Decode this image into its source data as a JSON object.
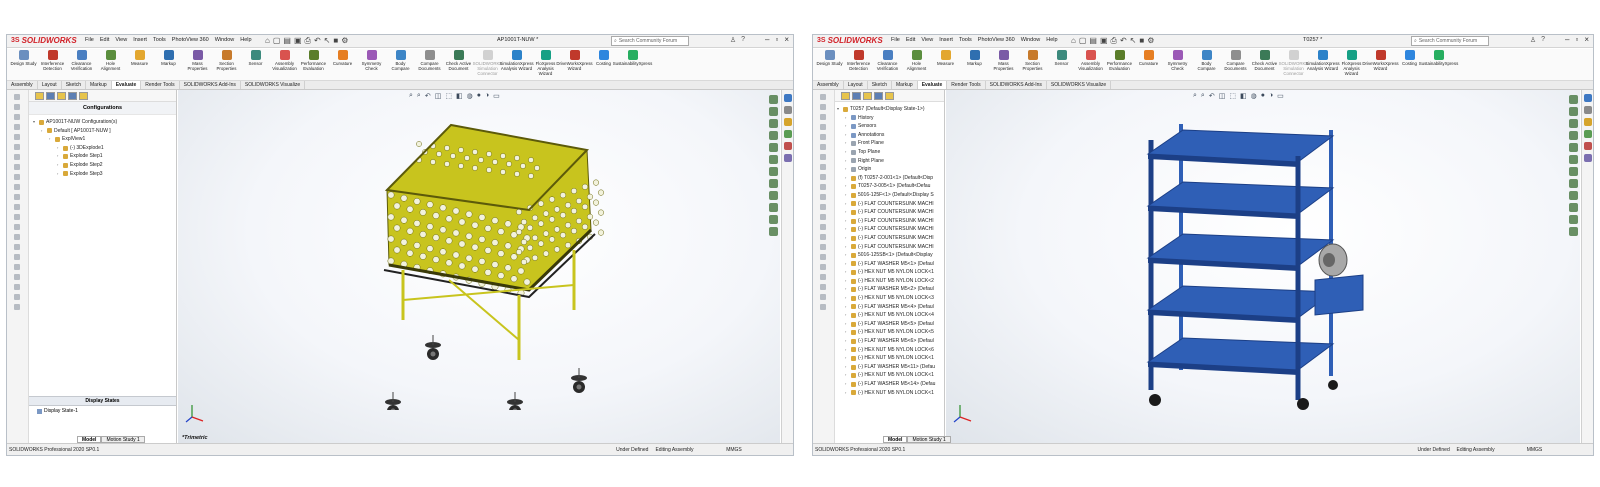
{
  "common": {
    "app_name": "SOLIDWORKS",
    "app_mark": "3S",
    "menus": [
      "File",
      "Edit",
      "View",
      "Insert",
      "Tools",
      "PhotoView 360",
      "Window",
      "Help"
    ],
    "search_placeholder": "Search Community Forum",
    "tools": [
      "Design Study",
      "Interference Detection",
      "Clearance Verification",
      "Hole Alignment",
      "Measure",
      "Markup",
      "Mass Properties",
      "Section Properties",
      "Sensor",
      "Assembly Visualization",
      "Performance Evaluation",
      "Curvature",
      "Symmetry Check",
      "Body Compare",
      "Compare Documents",
      "Check Active Document",
      "SOLIDWORKS Simulation Connector",
      "SimulationXpress Analysis Wizard",
      "FloXpress Analysis Wizard",
      "DriveWorksXpress Wizard",
      "Costing",
      "SustainabilityXpress"
    ],
    "tabs": [
      "Assembly",
      "Layout",
      "Sketch",
      "Markup",
      "Evaluate",
      "Render Tools",
      "SOLIDWORKS Add-Ins",
      "SOLIDWORKS Visualize"
    ],
    "active_tab": "Evaluate",
    "bottom_tabs": [
      "Model",
      "Motion Study 1"
    ],
    "status": {
      "product": "SOLIDWORKS Professional 2020 SP0.1",
      "state": "Under Defined",
      "mode": "Editing Assembly",
      "units": "MMGS"
    }
  },
  "left": {
    "doc_title": "AP1001T-NUW *",
    "panel_title": "Configurations",
    "tree": [
      {
        "text": "AP1001T-NUW Configuration(s)",
        "depth": 0
      },
      {
        "text": "Default [ AP1001T-NUW ]",
        "depth": 1
      },
      {
        "text": "ExplView1",
        "depth": 2
      },
      {
        "text": "(-) 3DExplode1",
        "depth": 3
      },
      {
        "text": "Explode Step1",
        "depth": 3
      },
      {
        "text": "Explode Step2",
        "depth": 3
      },
      {
        "text": "Explode Step3",
        "depth": 3
      }
    ],
    "display_states_title": "Display States",
    "display_state": "Display State-1",
    "view_name": "*Trimetric",
    "model_color": "#c8c41e"
  },
  "right": {
    "doc_title": "T0257 *",
    "tree": [
      {
        "text": "T0257 (Default<Display State-1>)",
        "depth": 0,
        "k": "a"
      },
      {
        "text": "History",
        "depth": 1,
        "k": "f"
      },
      {
        "text": "Sensors",
        "depth": 1,
        "k": "f"
      },
      {
        "text": "Annotations",
        "depth": 1,
        "k": "f"
      },
      {
        "text": "Front Plane",
        "depth": 1,
        "k": "p"
      },
      {
        "text": "Top Plane",
        "depth": 1,
        "k": "p"
      },
      {
        "text": "Right Plane",
        "depth": 1,
        "k": "p"
      },
      {
        "text": "Origin",
        "depth": 1,
        "k": "p"
      },
      {
        "text": "(f) T0257-2-001<1> (Default<Disp",
        "depth": 1,
        "k": "a"
      },
      {
        "text": "T0257-3-005<1> (Default<Defau",
        "depth": 1,
        "k": "a"
      },
      {
        "text": "5016-125F<1> (Default<Display S",
        "depth": 1,
        "k": "a"
      },
      {
        "text": "(-) FLAT COUNTERSUNK MACHI",
        "depth": 1,
        "k": "a"
      },
      {
        "text": "(-) FLAT COUNTERSUNK MACHI",
        "depth": 1,
        "k": "a"
      },
      {
        "text": "(-) FLAT COUNTERSUNK MACHI",
        "depth": 1,
        "k": "a"
      },
      {
        "text": "(-) FLAT COUNTERSUNK MACHI",
        "depth": 1,
        "k": "a"
      },
      {
        "text": "(-) FLAT COUNTERSUNK MACHI",
        "depth": 1,
        "k": "a"
      },
      {
        "text": "(-) FLAT COUNTERSUNK MACHI",
        "depth": 1,
        "k": "a"
      },
      {
        "text": "5016-125SB<1> (Default<Display",
        "depth": 1,
        "k": "a"
      },
      {
        "text": "(-) FLAT WASHER M5<1> (Defaul",
        "depth": 1,
        "k": "a"
      },
      {
        "text": "(-) HEX NUT M5 NYLON LOCK<1",
        "depth": 1,
        "k": "a"
      },
      {
        "text": "(-) HEX NUT M5 NYLON LOCK<2",
        "depth": 1,
        "k": "a"
      },
      {
        "text": "(-) FLAT WASHER M5<2> (Defaul",
        "depth": 1,
        "k": "a"
      },
      {
        "text": "(-) HEX NUT M5 NYLON LOCK<3",
        "depth": 1,
        "k": "a"
      },
      {
        "text": "(-) FLAT WASHER M5<4> (Defaul",
        "depth": 1,
        "k": "a"
      },
      {
        "text": "(-) HEX NUT M5 NYLON LOCK<4",
        "depth": 1,
        "k": "a"
      },
      {
        "text": "(-) FLAT WASHER M5<5> (Defaul",
        "depth": 1,
        "k": "a"
      },
      {
        "text": "(-) HEX NUT M5 NYLON LOCK<5",
        "depth": 1,
        "k": "a"
      },
      {
        "text": "(-) FLAT WASHER M5<6> (Defaul",
        "depth": 1,
        "k": "a"
      },
      {
        "text": "(-) HEX NUT M5 NYLON LOCK<6",
        "depth": 1,
        "k": "a"
      },
      {
        "text": "(-) HEX NUT M5 NYLON LOCK<1",
        "depth": 1,
        "k": "a"
      },
      {
        "text": "(-) FLAT WASHER M5<11> (Defau",
        "depth": 1,
        "k": "a"
      },
      {
        "text": "(-) HEX NUT M5 NYLON LOCK<1",
        "depth": 1,
        "k": "a"
      },
      {
        "text": "(-) FLAT WASHER M5<14> (Defau",
        "depth": 1,
        "k": "a"
      },
      {
        "text": "(-) HEX NUT M5 NYLON LOCK<1",
        "depth": 1,
        "k": "a"
      }
    ],
    "model_color": "#2f5fb6"
  }
}
